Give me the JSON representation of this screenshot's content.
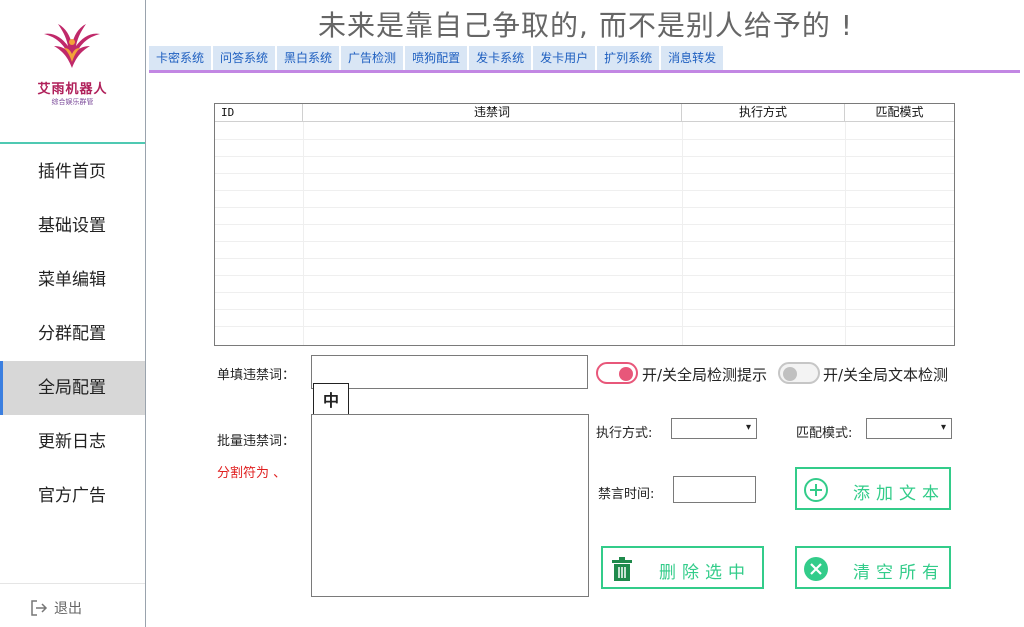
{
  "header": {
    "motto": "未来是靠自己争取的, 而不是别人给予的 !"
  },
  "logo": {
    "title": "艾雨机器人",
    "subtitle": "综合娱乐群管"
  },
  "sidebar": {
    "items": [
      {
        "label": "插件首页"
      },
      {
        "label": "基础设置"
      },
      {
        "label": "菜单编辑"
      },
      {
        "label": "分群配置"
      },
      {
        "label": "全局配置",
        "active": true
      },
      {
        "label": "更新日志"
      },
      {
        "label": "官方广告"
      }
    ],
    "logout_label": "退出"
  },
  "tabs": [
    "卡密系统",
    "问答系统",
    "黑白系统",
    "广告检测",
    "喷狗配置",
    "发卡系统",
    "发卡用户",
    "扩列系统",
    "消息转发"
  ],
  "table": {
    "columns": [
      "ID",
      "违禁词",
      "执行方式",
      "匹配模式"
    ],
    "rows": []
  },
  "form": {
    "single_label": "单填违禁词：",
    "single_value": "",
    "ime_indicator": "中",
    "batch_label": "批量违禁词：",
    "separator_note": "分割符为 、",
    "toggle_tip_label": "开/关全局检测提示",
    "toggle_tip_on": true,
    "toggle_text_label": "开/关全局文本检测",
    "toggle_text_on": false,
    "exec_mode_label": "执行方式:",
    "exec_mode_value": "",
    "match_mode_label": "匹配模式:",
    "match_mode_value": "",
    "mute_time_label": "禁言时间:",
    "mute_time_value": ""
  },
  "buttons": {
    "add_text": "添加文本",
    "delete_selected": "删除选中",
    "clear_all": "清空所有"
  },
  "colors": {
    "accent_green": "#33cc8a",
    "tab_underline": "#c287e3",
    "toggle_on": "#e8577a",
    "note_red": "#e02020"
  }
}
